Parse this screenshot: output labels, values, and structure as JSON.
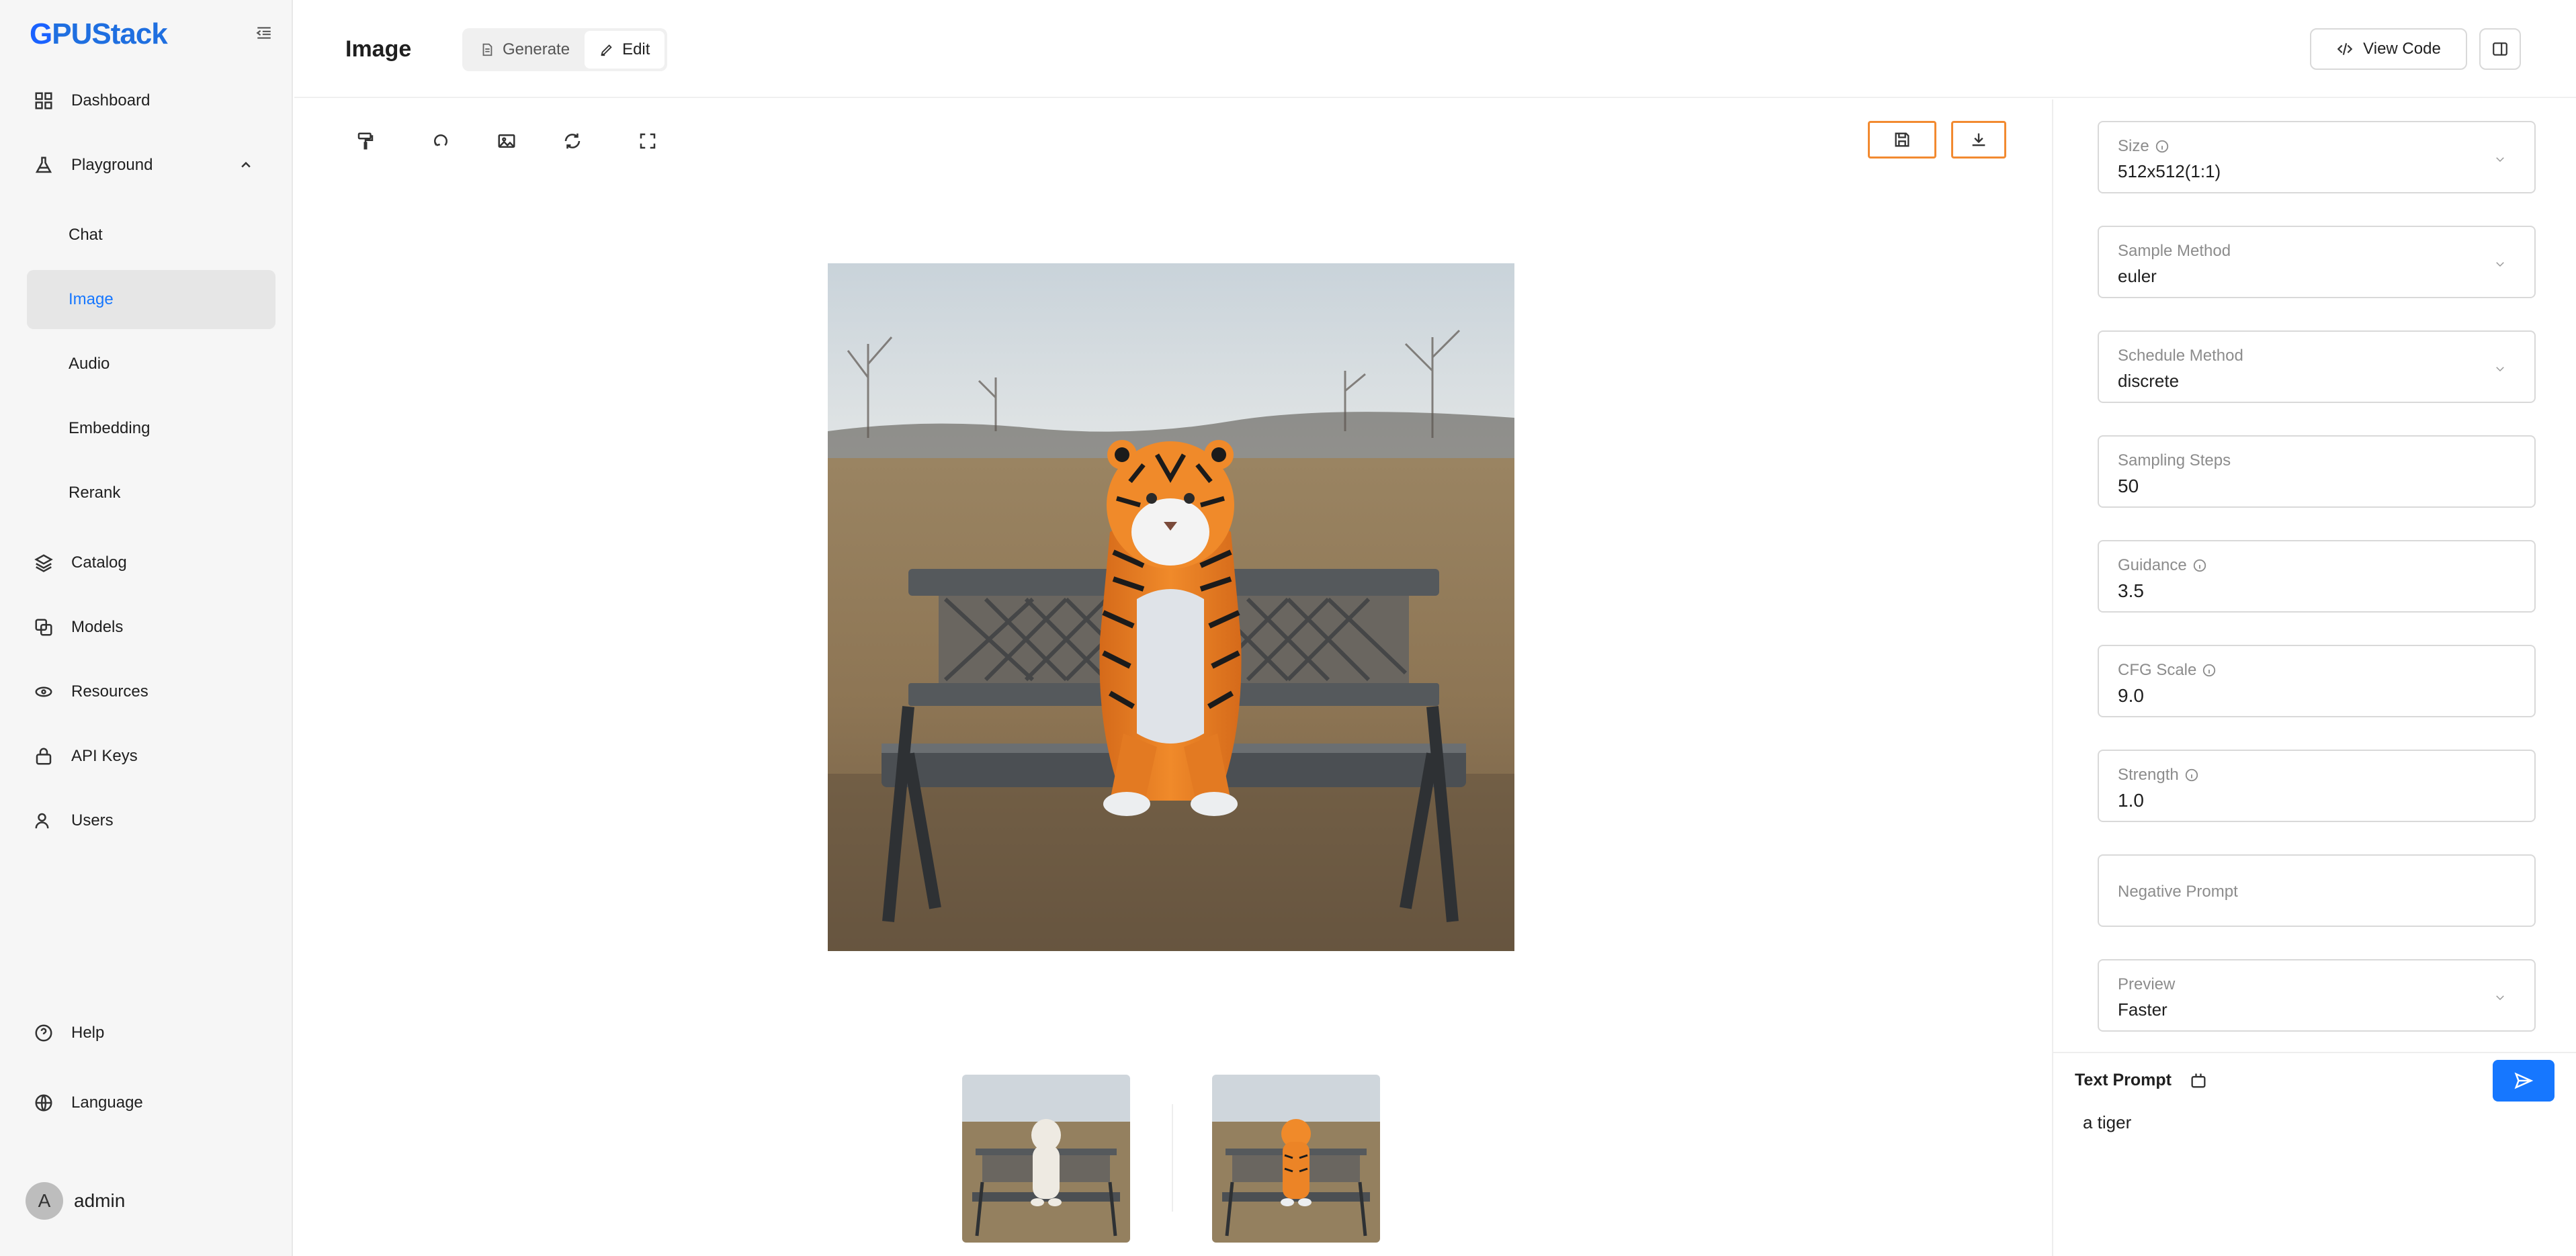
{
  "app": {
    "logo_first": "G",
    "logo_rest": "PUStack",
    "accent_color": "#1677ff"
  },
  "sidebar": {
    "items": [
      {
        "label": "Dashboard",
        "icon": "dashboard-icon"
      },
      {
        "label": "Playground",
        "icon": "flask-icon",
        "expanded": true
      },
      {
        "label": "Catalog",
        "icon": "layers-icon"
      },
      {
        "label": "Models",
        "icon": "models-icon"
      },
      {
        "label": "Resources",
        "icon": "resources-icon"
      },
      {
        "label": "API Keys",
        "icon": "lock-icon"
      },
      {
        "label": "Users",
        "icon": "users-icon"
      }
    ],
    "playground_sub": [
      {
        "label": "Chat"
      },
      {
        "label": "Image",
        "active": true
      },
      {
        "label": "Audio"
      },
      {
        "label": "Embedding"
      },
      {
        "label": "Rerank"
      }
    ],
    "footer": [
      {
        "label": "Help",
        "icon": "help-icon"
      },
      {
        "label": "Language",
        "icon": "globe-icon"
      }
    ],
    "user": {
      "avatar_letter": "A",
      "name": "admin"
    }
  },
  "header": {
    "title": "Image",
    "tabs": [
      {
        "label": "Generate",
        "active": false
      },
      {
        "label": "Edit",
        "active": true
      }
    ],
    "view_code_label": "View Code"
  },
  "toolbar": {
    "tools": [
      "brush-icon",
      "undo-icon",
      "image-icon",
      "refresh-icon",
      "fullscreen-icon"
    ],
    "highlighted": [
      "save-icon",
      "download-icon"
    ],
    "highlight_color": "#f28a30"
  },
  "canvas": {
    "main_image": "tiger sitting on a park bench",
    "thumbnails": [
      "white dog on a park bench",
      "tiger on a park bench"
    ]
  },
  "params": {
    "size": {
      "label": "Size",
      "value": "512x512(1:1)"
    },
    "sample_method": {
      "label": "Sample Method",
      "value": "euler"
    },
    "schedule_method": {
      "label": "Schedule Method",
      "value": "discrete"
    },
    "sampling_steps": {
      "label": "Sampling Steps",
      "value": "50"
    },
    "guidance": {
      "label": "Guidance",
      "value": "3.5"
    },
    "cfg_scale": {
      "label": "CFG Scale",
      "value": "9.0"
    },
    "strength": {
      "label": "Strength",
      "value": "1.0"
    },
    "negative_prompt": {
      "placeholder": "Negative Prompt"
    },
    "preview": {
      "label": "Preview",
      "value": "Faster"
    }
  },
  "prompt": {
    "label": "Text Prompt",
    "value": "a tiger"
  }
}
